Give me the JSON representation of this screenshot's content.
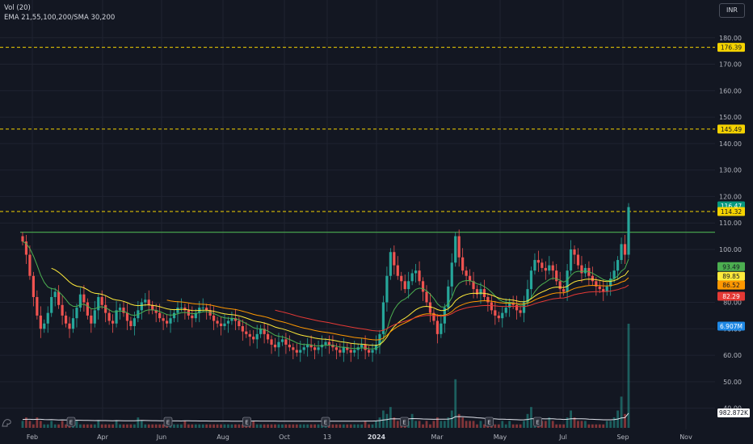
{
  "legend": {
    "volume": "Vol (20)",
    "indicators": "EMA 21,55,100,200/SMA 30,200"
  },
  "currency": "INR",
  "chart_data": {
    "type": "candlestick",
    "ylim": [
      35,
      190
    ],
    "y_ticks": [
      40,
      50,
      60,
      70,
      80,
      90,
      100,
      110,
      120,
      130,
      140,
      150,
      160,
      170,
      180
    ],
    "x_tick_labels": [
      "Feb",
      "Apr",
      "Jun",
      "Aug",
      "Oct",
      "13",
      "2024",
      "Mar",
      "May",
      "Jul",
      "Sep",
      "Nov"
    ],
    "horizontal_levels": [
      {
        "value": 176.39,
        "label": "176.39",
        "style": "dashed",
        "color": "#f5d300"
      },
      {
        "value": 145.49,
        "label": "145.49",
        "style": "dashed",
        "color": "#f5d300"
      },
      {
        "value": 114.32,
        "label": "114.32",
        "style": "dashed",
        "color": "#f5d300"
      }
    ],
    "resistance_line": {
      "value": 106.5,
      "color": "#4caf50"
    },
    "price_labels": [
      {
        "value": 116.47,
        "label": "116.47",
        "bg": "#089981",
        "fg": "#ffffff"
      },
      {
        "value": 114.32,
        "label": "114.32",
        "bg": "#f5d300",
        "fg": "#131722"
      },
      {
        "value": 93.49,
        "label": "93.49",
        "bg": "#4caf50",
        "fg": "#131722"
      },
      {
        "value": 89.85,
        "label": "89.85",
        "bg": "#ffeb3b",
        "fg": "#131722"
      },
      {
        "value": 86.52,
        "label": "86.52",
        "bg": "#ff9800",
        "fg": "#131722"
      },
      {
        "value": 82.29,
        "label": "82.29",
        "bg": "#e53935",
        "fg": "#ffffff"
      },
      {
        "value": 71.0,
        "label": "6.907M",
        "bg": "#1e88e5",
        "fg": "#ffffff"
      }
    ],
    "close_series": [
      103,
      98,
      90,
      82,
      75,
      70,
      72,
      76,
      82,
      84,
      79,
      75,
      72,
      70,
      74,
      78,
      83,
      80,
      75,
      72,
      77,
      82,
      79,
      76,
      73,
      72,
      77,
      78,
      76,
      73,
      71,
      74,
      77,
      80,
      81,
      79,
      77,
      76,
      74,
      73,
      72,
      74,
      76,
      78,
      78,
      77,
      75,
      74,
      76,
      78,
      78,
      77,
      75,
      73,
      72,
      71,
      72,
      73,
      74,
      73,
      71,
      69,
      68,
      67,
      66,
      68,
      70,
      68,
      66,
      64,
      63,
      65,
      66,
      64,
      63,
      62,
      61,
      62,
      63,
      64,
      63,
      62,
      63,
      64,
      65,
      64,
      63,
      62,
      61,
      63,
      62,
      61,
      62,
      63,
      64,
      62,
      61,
      62,
      64,
      68,
      80,
      90,
      99,
      94,
      90,
      88,
      85,
      88,
      91,
      92,
      88,
      84,
      80,
      76,
      73,
      68,
      72,
      78,
      86,
      95,
      105,
      97,
      92,
      90,
      88,
      85,
      83,
      85,
      82,
      80,
      77,
      75,
      74,
      76,
      78,
      80,
      79,
      77,
      76,
      80,
      85,
      92,
      96,
      95,
      93,
      92,
      94,
      92,
      88,
      85,
      84,
      92,
      100,
      98,
      94,
      91,
      93,
      90,
      88,
      86,
      85,
      84,
      86,
      89,
      92,
      96,
      102,
      98,
      116
    ],
    "volume_series": [
      2,
      3,
      2,
      1,
      3,
      2,
      1,
      1,
      2,
      1,
      1,
      2,
      1,
      1,
      1,
      2,
      1,
      1,
      1,
      1,
      1,
      2,
      1,
      1,
      1,
      1,
      2,
      1,
      1,
      1,
      1,
      1,
      3,
      2,
      1,
      1,
      1,
      1,
      1,
      1,
      1,
      1,
      1,
      1,
      1,
      2,
      1,
      1,
      1,
      1,
      1,
      1,
      1,
      1,
      1,
      1,
      1,
      1,
      1,
      1,
      1,
      1,
      1,
      1,
      2,
      1,
      1,
      1,
      1,
      1,
      1,
      1,
      1,
      1,
      1,
      1,
      1,
      1,
      1,
      1,
      1,
      1,
      1,
      1,
      1,
      1,
      1,
      1,
      1,
      1,
      1,
      1,
      1,
      1,
      1,
      2,
      1,
      1,
      2,
      3,
      5,
      4,
      6,
      3,
      2,
      2,
      3,
      2,
      4,
      2,
      2,
      1,
      2,
      1,
      2,
      3,
      2,
      2,
      3,
      5,
      14,
      4,
      3,
      2,
      2,
      2,
      1,
      2,
      1,
      2,
      1,
      1,
      1,
      2,
      1,
      2,
      1,
      1,
      1,
      2,
      4,
      6,
      3,
      2,
      2,
      2,
      3,
      2,
      1,
      1,
      1,
      3,
      5,
      3,
      2,
      2,
      2,
      1,
      1,
      1,
      1,
      1,
      2,
      2,
      3,
      5,
      9,
      4,
      30
    ],
    "event_markers": {
      "symbol": "E",
      "label": "earnings-marker",
      "positions": [
        0.08,
        0.24,
        0.37,
        0.5,
        0.63,
        0.77,
        0.85
      ]
    },
    "volume_label": "982.872K"
  }
}
